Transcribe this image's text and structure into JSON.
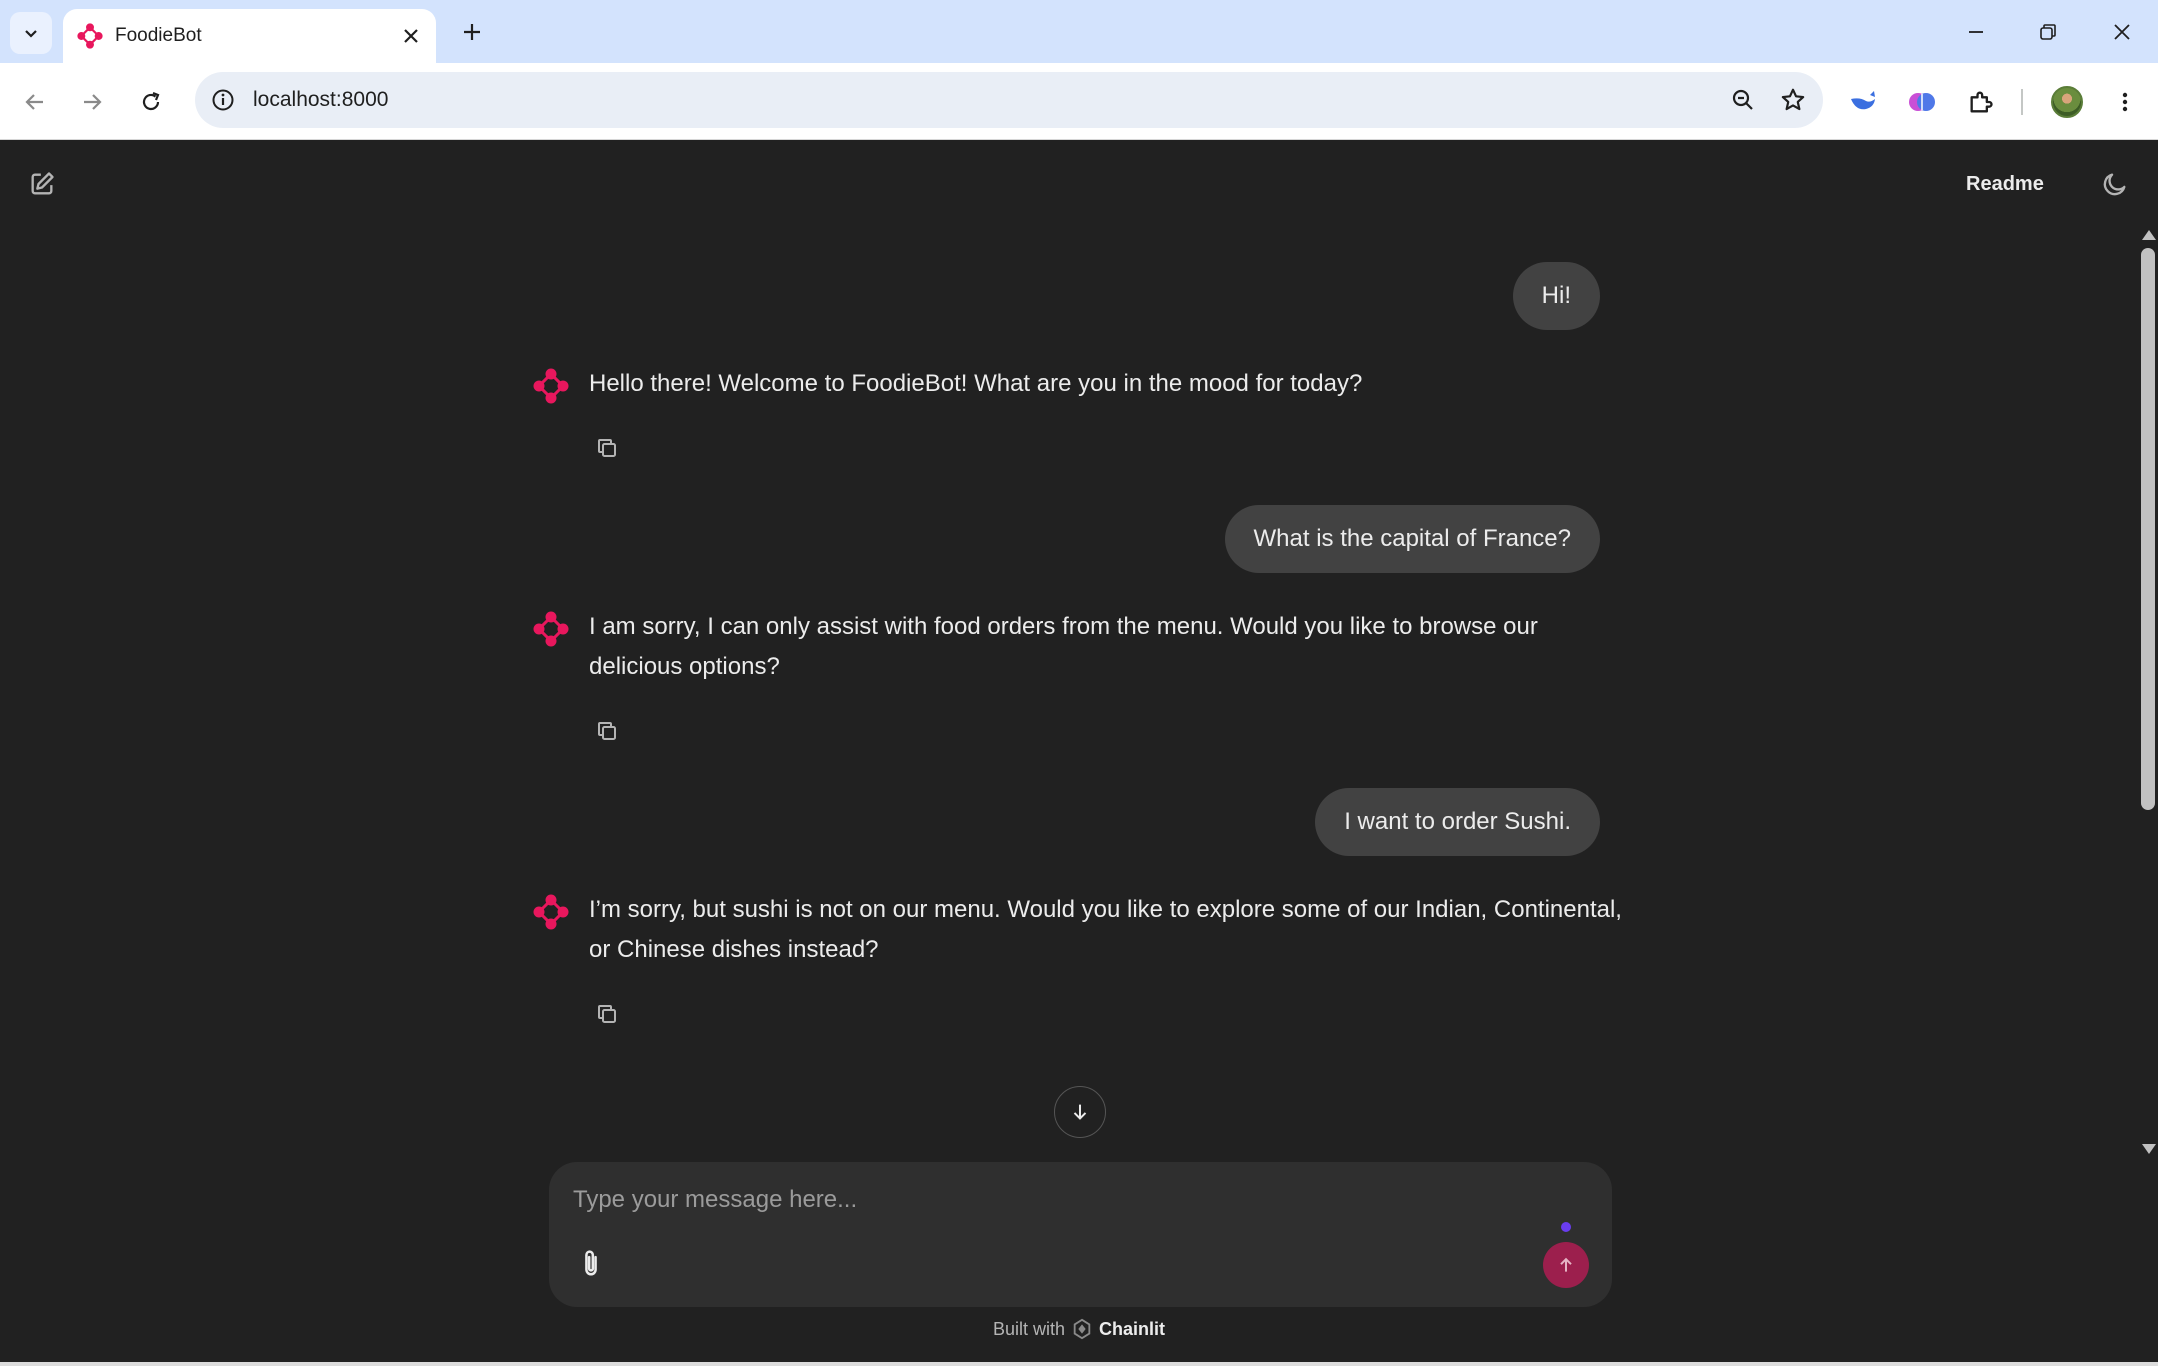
{
  "browser": {
    "tab_title": "FoodieBot",
    "url": "localhost:8000"
  },
  "header": {
    "readme_label": "Readme"
  },
  "messages": [
    {
      "role": "user",
      "text": "Hi!"
    },
    {
      "role": "assistant",
      "text": "Hello there! Welcome to FoodieBot! What are you in the mood for today?"
    },
    {
      "role": "user",
      "text": "What is the capital of France?"
    },
    {
      "role": "assistant",
      "text": "I am sorry, I can only assist with food orders from the menu. Would you like to browse our delicious options?"
    },
    {
      "role": "user",
      "text": "I want to order Sushi."
    },
    {
      "role": "assistant",
      "text": "I’m sorry, but sushi is not on our menu. Would you like to explore some of our Indian, Continental, or Chinese dishes instead?"
    }
  ],
  "composer": {
    "placeholder": "Type your message here..."
  },
  "footer": {
    "built_with": "Built with",
    "brand": "Chainlit"
  },
  "colors": {
    "accent": "#e8175d",
    "send_button": "#9c1f4d",
    "background": "#212121",
    "user_bubble": "#424242"
  },
  "icons": [
    "chevron-down-icon",
    "close-icon",
    "plus-icon",
    "back-icon",
    "forward-icon",
    "reload-icon",
    "info-icon",
    "zoom-icon",
    "star-icon",
    "extension-icon",
    "more-icon",
    "new-chat-icon",
    "moon-icon",
    "copy-icon",
    "arrow-down-icon",
    "paperclip-icon",
    "arrow-up-icon",
    "foodiebot-logo-icon"
  ]
}
